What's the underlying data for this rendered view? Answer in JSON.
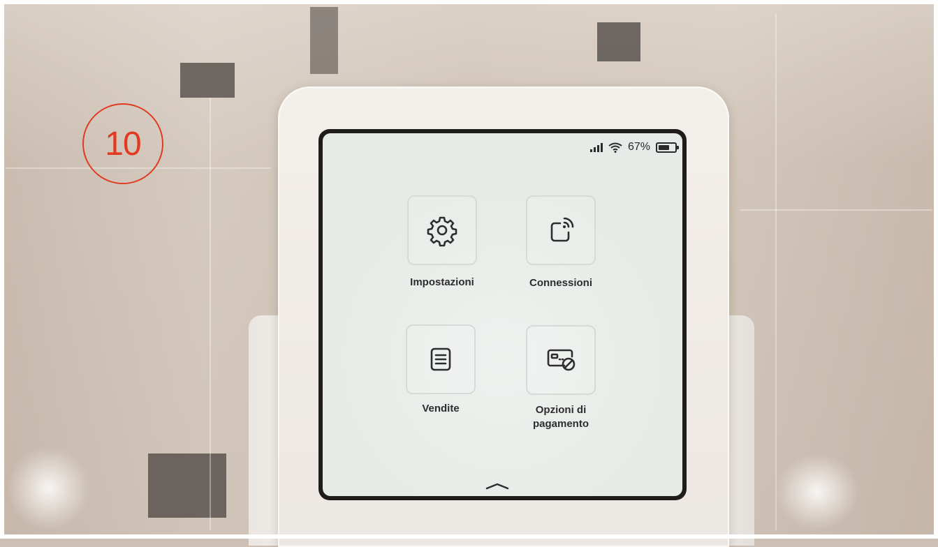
{
  "step_badge": {
    "number": "10",
    "color": "#e03a22"
  },
  "status_bar": {
    "signal_icon": "cellular-signal-icon",
    "wifi_icon": "wifi-icon",
    "battery_percent_text": "67%",
    "battery_level": 0.67,
    "battery_icon": "battery-icon"
  },
  "menu": {
    "items": [
      {
        "id": "settings",
        "label": "Impostazioni",
        "icon": "gear-icon"
      },
      {
        "id": "connections",
        "label": "Connessioni",
        "icon": "contactless-device-icon"
      },
      {
        "id": "sales",
        "label": "Vendite",
        "icon": "document-list-icon"
      },
      {
        "id": "payment_options",
        "label_line1": "Opzioni di",
        "label_line2": "pagamento",
        "icon": "card-payment-icon"
      }
    ]
  },
  "swipe_up_icon": "chevron-up-icon"
}
